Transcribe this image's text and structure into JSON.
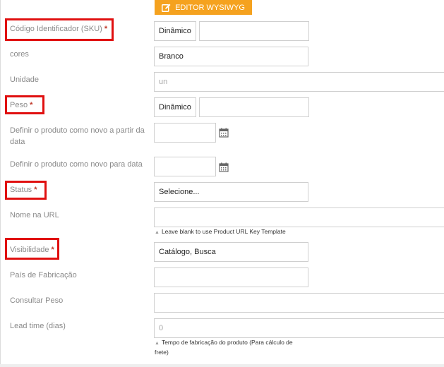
{
  "editor_button": {
    "label": "EDITOR WYSIWYG",
    "icon": "edit-icon",
    "color": "#f5a21f"
  },
  "fields": {
    "sku": {
      "label": "Código Identificador (SKU)",
      "required": "*",
      "select_value": "Dinâmico",
      "value": ""
    },
    "cores": {
      "label": "cores",
      "value": "Branco"
    },
    "unidade": {
      "label": "Unidade",
      "placeholder": "un"
    },
    "peso": {
      "label": "Peso",
      "required": "*",
      "select_value": "Dinâmico",
      "value": ""
    },
    "novo_de": {
      "label": "Definir o produto como novo a partir da data",
      "value": "",
      "icon": "calendar-icon"
    },
    "novo_para": {
      "label": "Definir o produto como novo para data",
      "value": "",
      "icon": "calendar-icon"
    },
    "status": {
      "label": "Status",
      "required": "*",
      "value": "Selecione..."
    },
    "url": {
      "label": "Nome na URL",
      "value": "",
      "note": "Leave blank to use Product URL Key Template"
    },
    "visibilidade": {
      "label": "Visibilidade",
      "required": "*",
      "value": "Catálogo, Busca"
    },
    "pais": {
      "label": "País de Fabricação",
      "value": ""
    },
    "consultar_peso": {
      "label": "Consultar Peso",
      "value": ""
    },
    "lead_time": {
      "label": "Lead time (dias)",
      "placeholder": "0",
      "note": "Tempo de fabricação do produto (Para cálculo de frete)"
    }
  },
  "highlight_color": "#e01010"
}
